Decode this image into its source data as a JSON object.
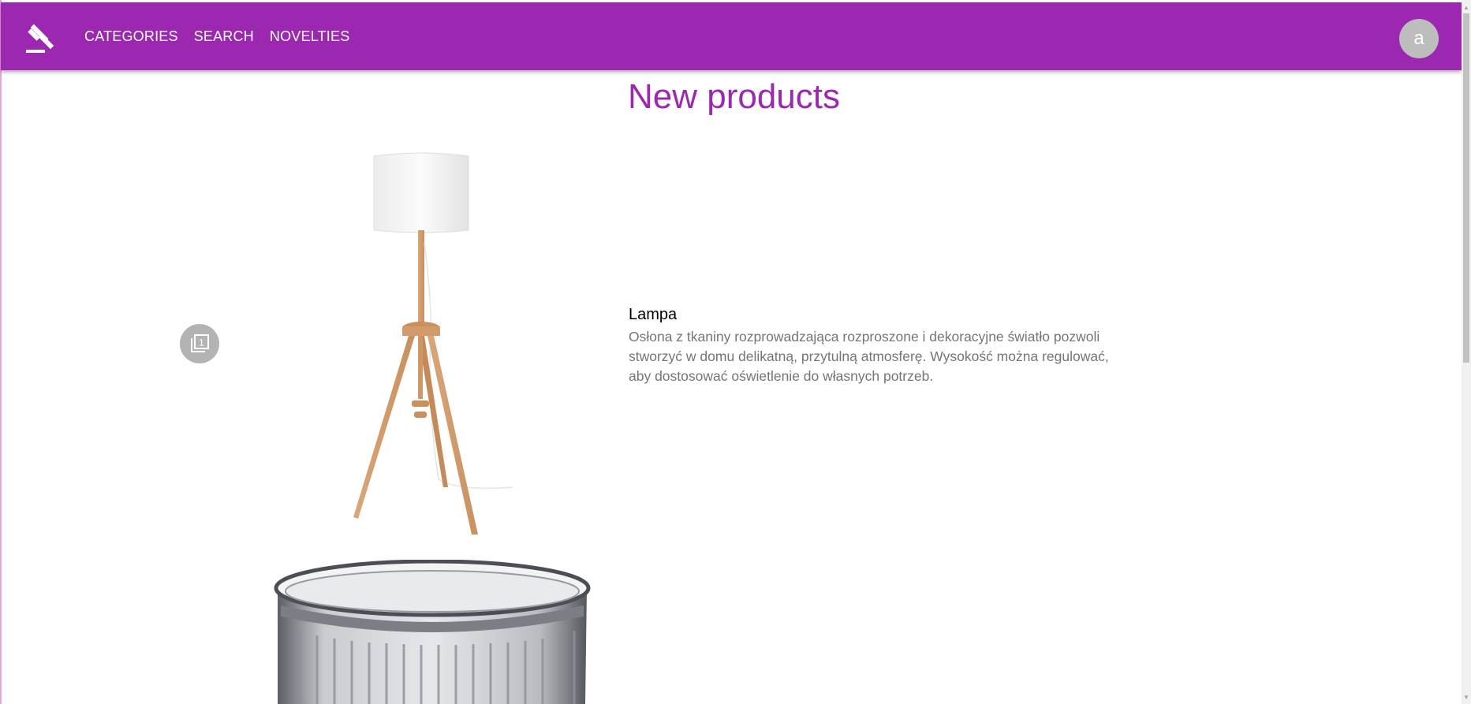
{
  "colors": {
    "brand": "#9c27b0",
    "avatar_bg": "#bdbdbd",
    "desc_text": "#757575"
  },
  "nav": {
    "items": [
      {
        "label": "CATEGORIES"
      },
      {
        "label": "SEARCH"
      },
      {
        "label": "NOVELTIES"
      }
    ],
    "logo_icon": "gavel-icon"
  },
  "user": {
    "avatar_letter": "a"
  },
  "page": {
    "title": "New products"
  },
  "carousel": {
    "counter_icon": "filter-1-icon",
    "counter_value": "1"
  },
  "products": [
    {
      "name": "Lampa",
      "description": "Osłona z tkaniny rozprowadzająca rozproszone i dekoracyjne światło pozwoli stworzyć w domu delikatną, przytulną atmosferę. Wysokość można regulować, aby dostosować oświetlenie do własnych potrzeb.",
      "image_icon": "floor-lamp-image"
    },
    {
      "image_icon": "glass-image"
    }
  ]
}
